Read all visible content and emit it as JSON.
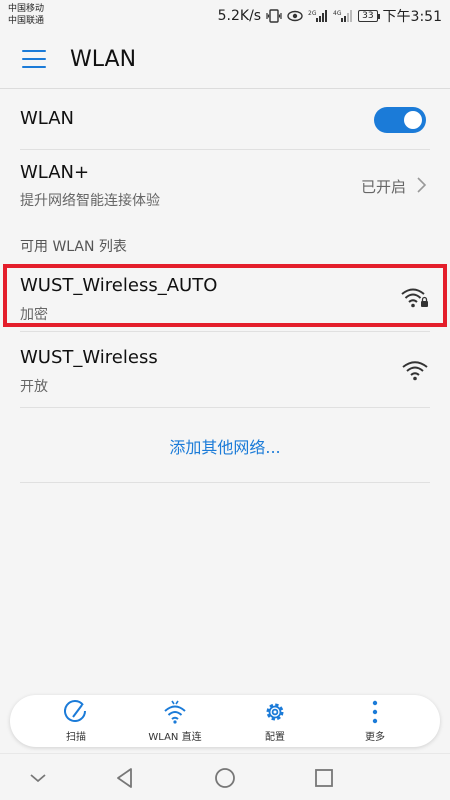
{
  "status_bar": {
    "carrier_1": "中国移动",
    "carrier_2": "中国联通",
    "speed": "5.2K/s",
    "net_2g": "2G",
    "net_4g": "4G",
    "battery": "33",
    "time": "下午3:51"
  },
  "app_bar": {
    "title": "WLAN",
    "menu_icon": "menu-icon"
  },
  "wlan_toggle": {
    "label": "WLAN",
    "enabled": true
  },
  "wlan_plus": {
    "label": "WLAN+",
    "subtitle": "提升网络智能连接体验",
    "status": "已开启"
  },
  "section_header": "可用 WLAN 列表",
  "networks": [
    {
      "name": "WUST_Wireless_AUTO",
      "security": "加密",
      "icon": "wifi-locked-icon"
    },
    {
      "name": "WUST_Wireless",
      "security": "开放",
      "icon": "wifi-icon"
    }
  ],
  "add_network": "添加其他网络...",
  "toolbar": {
    "items": [
      {
        "label": "扫描",
        "icon": "scan-icon"
      },
      {
        "label": "WLAN 直连",
        "icon": "wifi-direct-icon"
      },
      {
        "label": "配置",
        "icon": "gear-icon"
      },
      {
        "label": "更多",
        "icon": "more-icon"
      }
    ]
  },
  "colors": {
    "accent": "#1b7bd8",
    "highlight": "#e41e2b",
    "background": "#f5f5f5"
  }
}
